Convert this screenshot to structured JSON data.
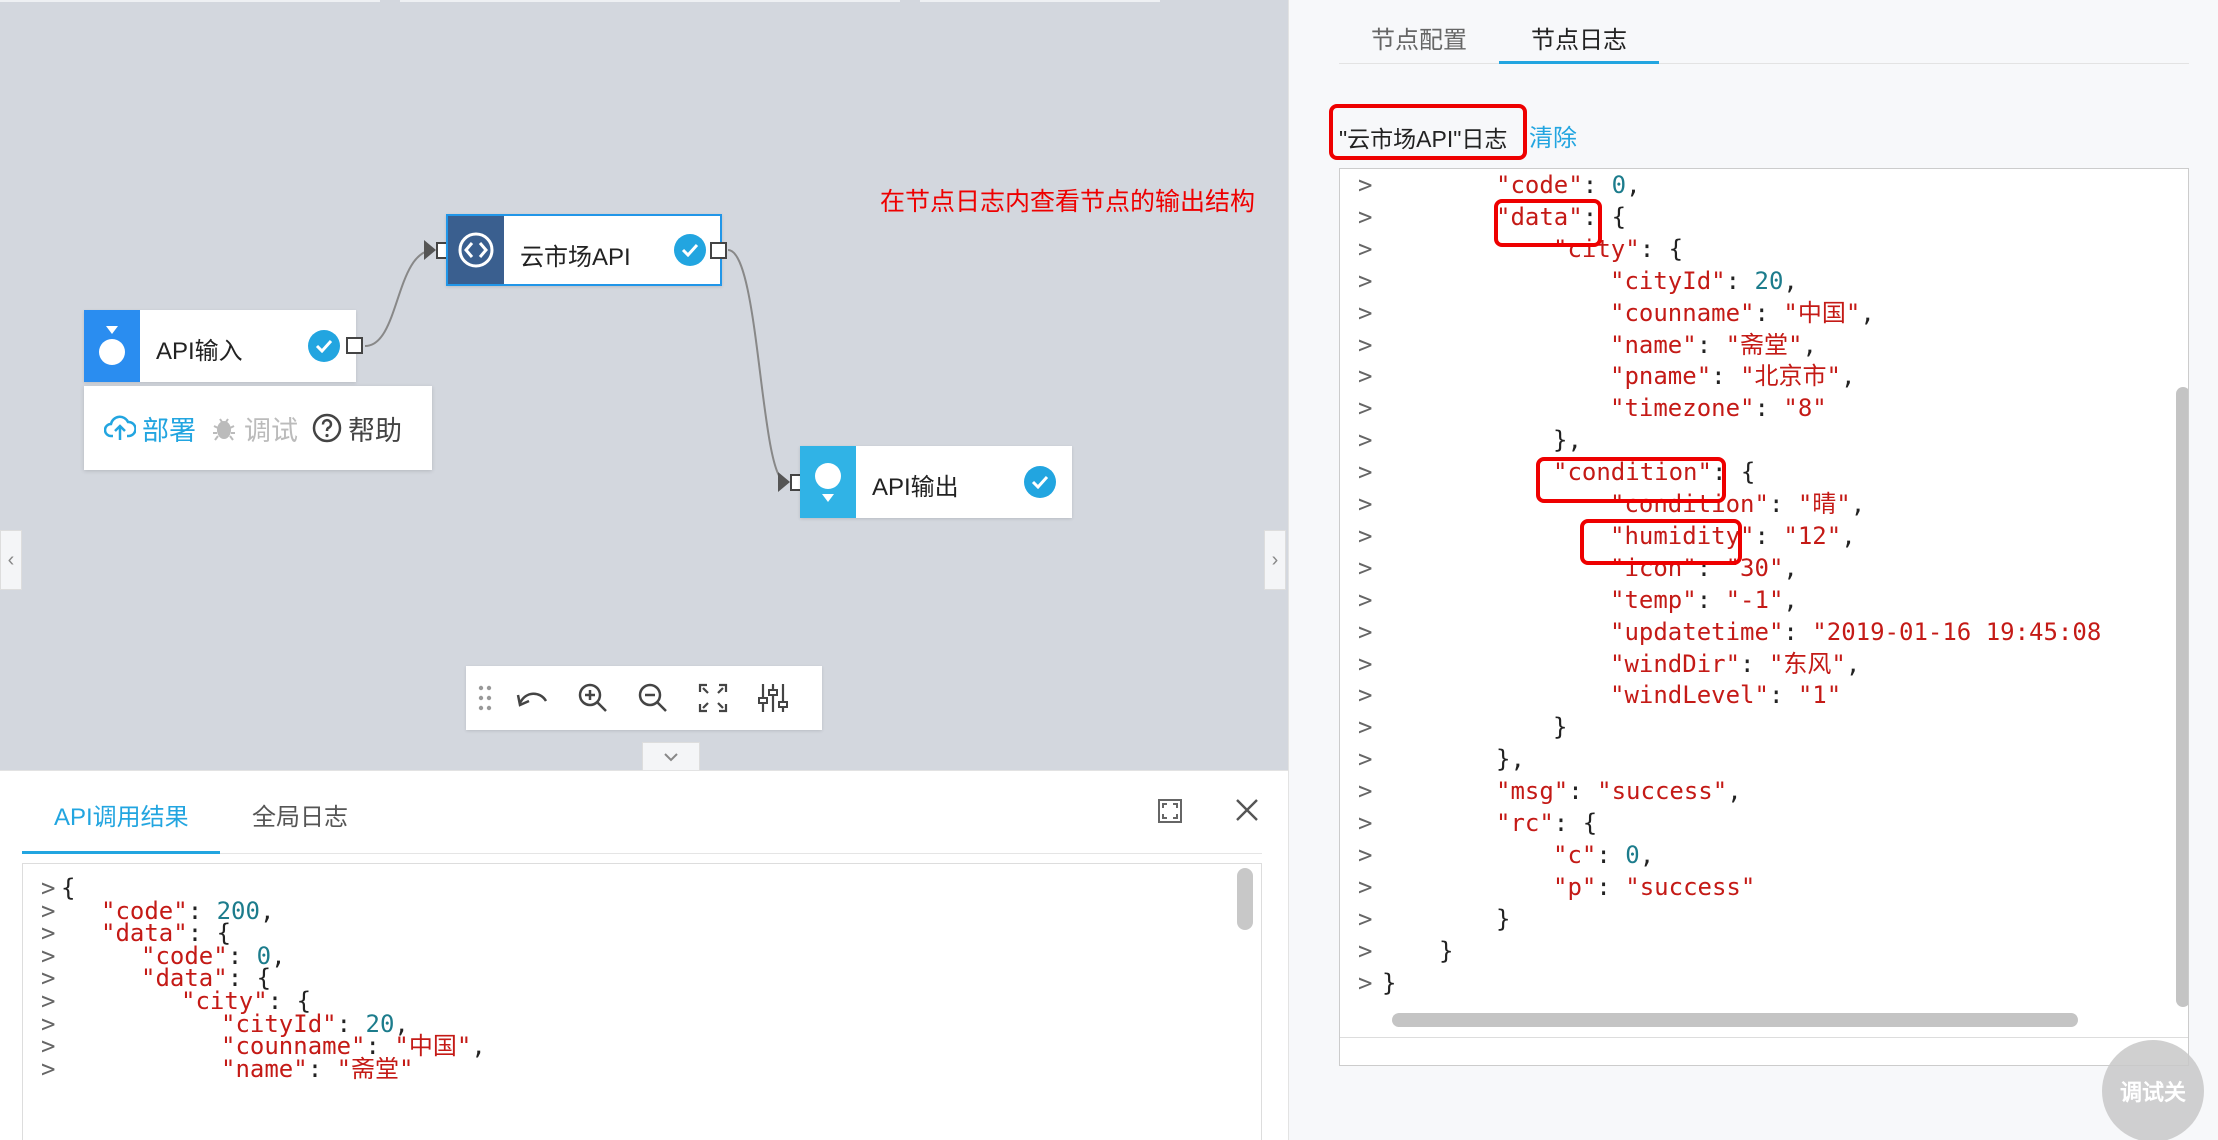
{
  "nodes": {
    "input": {
      "label": "API输入"
    },
    "market": {
      "label": "云市场API"
    },
    "output": {
      "label": "API输出"
    }
  },
  "node_menu": {
    "deploy": "部署",
    "debug": "调试",
    "help": "帮助"
  },
  "toolbar": {
    "icons": [
      "drag-handle-icon",
      "undo-icon",
      "zoom-in-icon",
      "zoom-out-icon",
      "fit-screen-icon",
      "settings-sliders-icon"
    ]
  },
  "bottom_panel": {
    "tabs": [
      "API调用结果",
      "全局日志"
    ],
    "active_tab": 0,
    "code_lines": [
      {
        "indent": 0,
        "parts": [
          [
            "p",
            "{"
          ]
        ]
      },
      {
        "indent": 1,
        "parts": [
          [
            "k",
            "\"code\""
          ],
          [
            "p",
            ": "
          ],
          [
            "n",
            "200"
          ],
          [
            "p",
            ","
          ]
        ]
      },
      {
        "indent": 1,
        "parts": [
          [
            "k",
            "\"data\""
          ],
          [
            "p",
            ": {"
          ]
        ]
      },
      {
        "indent": 2,
        "parts": [
          [
            "k",
            "\"code\""
          ],
          [
            "p",
            ": "
          ],
          [
            "n",
            "0"
          ],
          [
            "p",
            ","
          ]
        ]
      },
      {
        "indent": 2,
        "parts": [
          [
            "k",
            "\"data\""
          ],
          [
            "p",
            ": {"
          ]
        ]
      },
      {
        "indent": 3,
        "parts": [
          [
            "k",
            "\"city\""
          ],
          [
            "p",
            ": {"
          ]
        ]
      },
      {
        "indent": 4,
        "parts": [
          [
            "k",
            "\"cityId\""
          ],
          [
            "p",
            ": "
          ],
          [
            "n",
            "20"
          ],
          [
            "p",
            ","
          ]
        ]
      },
      {
        "indent": 4,
        "parts": [
          [
            "k",
            "\"counname\""
          ],
          [
            "p",
            ": "
          ],
          [
            "s",
            "\"中国\""
          ],
          [
            "p",
            ","
          ]
        ]
      },
      {
        "indent": 4,
        "parts": [
          [
            "k",
            "\"name\""
          ],
          [
            "p",
            ": "
          ],
          [
            "s",
            "\"斋堂\""
          ]
        ]
      }
    ]
  },
  "right_panel": {
    "tabs": [
      "节点配置",
      "节点日志"
    ],
    "active_tab": 1,
    "log_title": "\"云市场API\"日志",
    "clear_label": "清除",
    "annotation": "在节点日志内查看节点的输出结构",
    "code_lines": [
      {
        "indent": 2,
        "parts": [
          [
            "k",
            "\"code\""
          ],
          [
            "p",
            ": "
          ],
          [
            "n",
            "0"
          ],
          [
            "p",
            ","
          ]
        ]
      },
      {
        "indent": 2,
        "parts": [
          [
            "k",
            "\"data\""
          ],
          [
            "p",
            ": {"
          ]
        ]
      },
      {
        "indent": 3,
        "parts": [
          [
            "k",
            "\"city\""
          ],
          [
            "p",
            ": {"
          ]
        ]
      },
      {
        "indent": 4,
        "parts": [
          [
            "k",
            "\"cityId\""
          ],
          [
            "p",
            ": "
          ],
          [
            "n",
            "20"
          ],
          [
            "p",
            ","
          ]
        ]
      },
      {
        "indent": 4,
        "parts": [
          [
            "k",
            "\"counname\""
          ],
          [
            "p",
            ": "
          ],
          [
            "s",
            "\"中国\""
          ],
          [
            "p",
            ","
          ]
        ]
      },
      {
        "indent": 4,
        "parts": [
          [
            "k",
            "\"name\""
          ],
          [
            "p",
            ": "
          ],
          [
            "s",
            "\"斋堂\""
          ],
          [
            "p",
            ","
          ]
        ]
      },
      {
        "indent": 4,
        "parts": [
          [
            "k",
            "\"pname\""
          ],
          [
            "p",
            ": "
          ],
          [
            "s",
            "\"北京市\""
          ],
          [
            "p",
            ","
          ]
        ]
      },
      {
        "indent": 4,
        "parts": [
          [
            "k",
            "\"timezone\""
          ],
          [
            "p",
            ": "
          ],
          [
            "s",
            "\"8\""
          ]
        ]
      },
      {
        "indent": 3,
        "parts": [
          [
            "p",
            "},"
          ]
        ]
      },
      {
        "indent": 3,
        "parts": [
          [
            "k",
            "\"condition\""
          ],
          [
            "p",
            ": {"
          ]
        ]
      },
      {
        "indent": 4,
        "parts": [
          [
            "k",
            "\"condition\""
          ],
          [
            "p",
            ": "
          ],
          [
            "s",
            "\"晴\""
          ],
          [
            "p",
            ","
          ]
        ]
      },
      {
        "indent": 4,
        "parts": [
          [
            "k",
            "\"humidity\""
          ],
          [
            "p",
            ": "
          ],
          [
            "s",
            "\"12\""
          ],
          [
            "p",
            ","
          ]
        ]
      },
      {
        "indent": 4,
        "parts": [
          [
            "k",
            "\"icon\""
          ],
          [
            "p",
            ": "
          ],
          [
            "s",
            "\"30\""
          ],
          [
            "p",
            ","
          ]
        ]
      },
      {
        "indent": 4,
        "parts": [
          [
            "k",
            "\"temp\""
          ],
          [
            "p",
            ": "
          ],
          [
            "s",
            "\"-1\""
          ],
          [
            "p",
            ","
          ]
        ]
      },
      {
        "indent": 4,
        "parts": [
          [
            "k",
            "\"updatetime\""
          ],
          [
            "p",
            ": "
          ],
          [
            "s",
            "\"2019-01-16 19:45:08"
          ]
        ]
      },
      {
        "indent": 4,
        "parts": [
          [
            "k",
            "\"windDir\""
          ],
          [
            "p",
            ": "
          ],
          [
            "s",
            "\"东风\""
          ],
          [
            "p",
            ","
          ]
        ]
      },
      {
        "indent": 4,
        "parts": [
          [
            "k",
            "\"windLevel\""
          ],
          [
            "p",
            ": "
          ],
          [
            "s",
            "\"1\""
          ]
        ]
      },
      {
        "indent": 3,
        "parts": [
          [
            "p",
            "}"
          ]
        ]
      },
      {
        "indent": 2,
        "parts": [
          [
            "p",
            "},"
          ]
        ]
      },
      {
        "indent": 2,
        "parts": [
          [
            "k",
            "\"msg\""
          ],
          [
            "p",
            ": "
          ],
          [
            "s",
            "\"success\""
          ],
          [
            "p",
            ","
          ]
        ]
      },
      {
        "indent": 2,
        "parts": [
          [
            "k",
            "\"rc\""
          ],
          [
            "p",
            ": {"
          ]
        ]
      },
      {
        "indent": 3,
        "parts": [
          [
            "k",
            "\"c\""
          ],
          [
            "p",
            ": "
          ],
          [
            "n",
            "0"
          ],
          [
            "p",
            ","
          ]
        ]
      },
      {
        "indent": 3,
        "parts": [
          [
            "k",
            "\"p\""
          ],
          [
            "p",
            ": "
          ],
          [
            "s",
            "\"success\""
          ]
        ]
      },
      {
        "indent": 2,
        "parts": [
          [
            "p",
            "}"
          ]
        ]
      },
      {
        "indent": 1,
        "parts": [
          [
            "p",
            "}"
          ]
        ]
      },
      {
        "indent": 0,
        "parts": [
          [
            "p",
            "}"
          ]
        ]
      }
    ]
  },
  "prompt_symbol": ">",
  "debug_fab": "调试关",
  "colors": {
    "accent": "#22a5e0",
    "annotation_red": "#ee0000",
    "canvas_bg": "#d3d7de",
    "json_string": "#c41a16",
    "json_number": "#1c7c8c"
  }
}
